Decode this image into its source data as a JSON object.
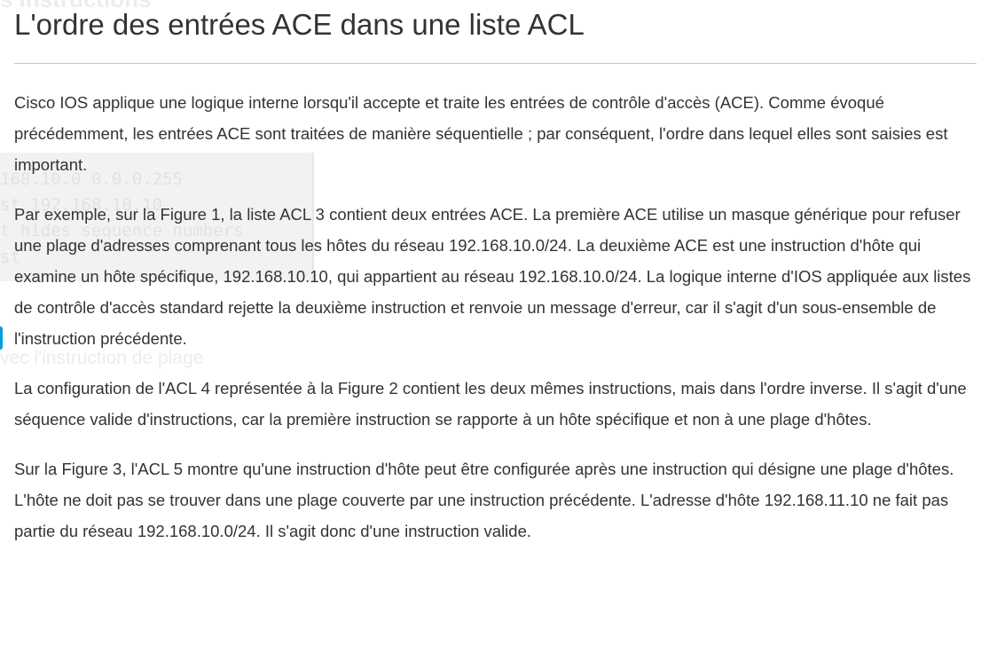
{
  "page": {
    "title": "L'ordre des entrées ACE dans une liste ACL",
    "paragraphs": [
      "Cisco IOS applique une logique interne lorsqu'il accepte et traite les entrées de contrôle d'accès (ACE). Comme évoqué précédemment, les entrées ACE sont traitées de manière séquentielle ; par conséquent, l'ordre dans lequel elles sont saisies est important.",
      "Par exemple, sur la Figure 1, la liste ACL 3 contient deux entrées ACE. La première ACE utilise un masque générique pour refuser une plage d'adresses comprenant tous les hôtes du réseau 192.168.10.0/24. La deuxième ACE est une instruction d'hôte qui examine un hôte spécifique, 192.168.10.10, qui appartient au réseau 192.168.10.0/24. La logique interne d'IOS appliquée aux listes de contrôle d'accès standard rejette la deuxième instruction et renvoie un message d'erreur, car il s'agit d'un sous-ensemble de l'instruction précédente.",
      "La configuration de l'ACL 4 représentée à la Figure 2 contient les deux mêmes instructions, mais dans l'ordre inverse. Il s'agit d'une séquence valide d'instructions, car la première instruction se rapporte à un hôte spécifique et non à une plage d'hôtes.",
      "Sur la Figure 3, l'ACL 5 montre qu'une instruction d'hôte peut être configurée après une instruction qui désigne une plage d'hôtes. L'hôte ne doit pas se trouver dans une plage couverte par une instruction précédente. L'adresse d'hôte 192.168.11.10 ne fait pas partie du réseau 192.168.10.0/24. Il s'agit donc d'une instruction valide."
    ]
  },
  "background_ghost": {
    "heading": "s instructions",
    "code_lines": [
      "168.10.0 0.0.0.255",
      "st 192.168.10.10",
      "t hides sequence numbers",
      "st"
    ],
    "caption": "vec l'instruction de plage"
  },
  "colors": {
    "text": "#333333",
    "divider": "#c8c8c8",
    "accent": "#049fd9"
  }
}
